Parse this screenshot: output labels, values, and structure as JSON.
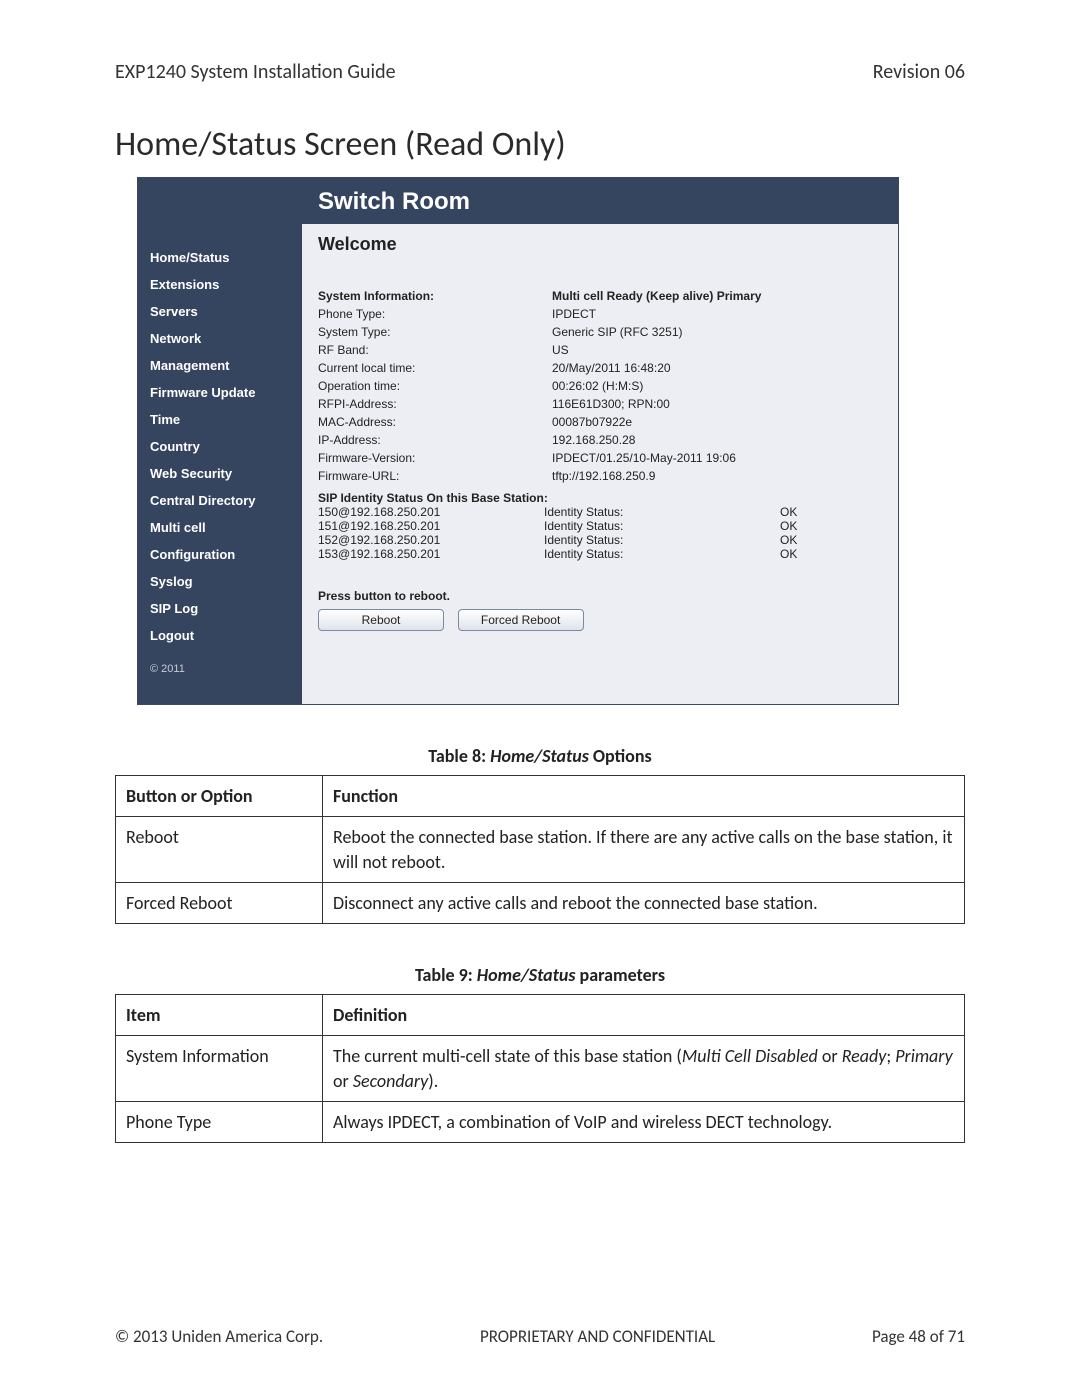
{
  "doc": {
    "header_left": "EXP1240 System Installation Guide",
    "header_right": "Revision 06",
    "section_title": "Home/Status Screen (Read Only)",
    "footer_left": "© 2013 Uniden America Corp.",
    "footer_center": "PROPRIETARY AND CONFIDENTIAL",
    "footer_right": "Page 48 of 71"
  },
  "ui": {
    "title": "Switch Room",
    "welcome": "Welcome",
    "copyright": "© 2011",
    "nav": {
      "0": "Home/Status",
      "1": "Extensions",
      "2": "Servers",
      "3": "Network",
      "4": "Management",
      "5": "Firmware Update",
      "6": "Time",
      "7": "Country",
      "8": "Web Security",
      "9": "Central Directory",
      "10": "Multi cell",
      "11": "Configuration",
      "12": "Syslog",
      "13": "SIP Log",
      "14": "Logout"
    },
    "sys": {
      "hdr_label": "System Information:",
      "hdr_value": "Multi cell Ready (Keep alive) Primary",
      "rows": {
        "0": {
          "k": "Phone Type:",
          "v": "IPDECT"
        },
        "1": {
          "k": "System Type:",
          "v": "Generic SIP (RFC 3251)"
        },
        "2": {
          "k": "RF Band:",
          "v": "US"
        },
        "3": {
          "k": "Current local time:",
          "v": "20/May/2011 16:48:20"
        },
        "4": {
          "k": "Operation time:",
          "v": "00:26:02 (H:M:S)"
        },
        "5": {
          "k": "RFPI-Address:",
          "v": "116E61D300; RPN:00"
        },
        "6": {
          "k": "MAC-Address:",
          "v": "00087b07922e"
        },
        "7": {
          "k": "IP-Address:",
          "v": "192.168.250.28"
        },
        "8": {
          "k": "Firmware-Version:",
          "v": "IPDECT/01.25/10-May-2011 19:06"
        },
        "9": {
          "k": "Firmware-URL:",
          "v": "tftp://192.168.250.9"
        }
      }
    },
    "sip": {
      "header": "SIP Identity Status On this Base Station:",
      "status_label": "Identity Status:",
      "rows": {
        "0": {
          "id": "150@192.168.250.201",
          "status": "OK"
        },
        "1": {
          "id": "151@192.168.250.201",
          "status": "OK"
        },
        "2": {
          "id": "152@192.168.250.201",
          "status": "OK"
        },
        "3": {
          "id": "153@192.168.250.201",
          "status": "OK"
        }
      }
    },
    "reboot_prompt": "Press button to reboot.",
    "buttons": {
      "reboot": "Reboot",
      "forced": "Forced Reboot"
    }
  },
  "table8": {
    "caption_prefix": "Table 8: ",
    "caption_italic": "Home/Status",
    "caption_suffix": " Options",
    "h1": "Button or Option",
    "h2": "Function",
    "r1c1": "Reboot",
    "r1c2": "Reboot the connected base station. If there are any active calls on the base station, it will not reboot.",
    "r2c1": "Forced Reboot",
    "r2c2": "Disconnect any active calls and reboot the connected base station."
  },
  "table9": {
    "caption_prefix": "Table 9: ",
    "caption_italic": "Home/Status",
    "caption_suffix": " parameters",
    "h1": "Item",
    "h2": "Definition",
    "r1c1": "System Information",
    "r1c2_a": "The current multi-cell state of this base station (",
    "r1c2_b": "Multi Cell Disabled",
    "r1c2_c": " or ",
    "r1c2_d": "Ready",
    "r1c2_e": "; ",
    "r1c2_f": "Primary",
    "r1c2_g": " or ",
    "r1c2_h": "Secondary",
    "r1c2_i": ").",
    "r2c1": "Phone Type",
    "r2c2": "Always IPDECT, a combination of VoIP and wireless DECT technology."
  }
}
